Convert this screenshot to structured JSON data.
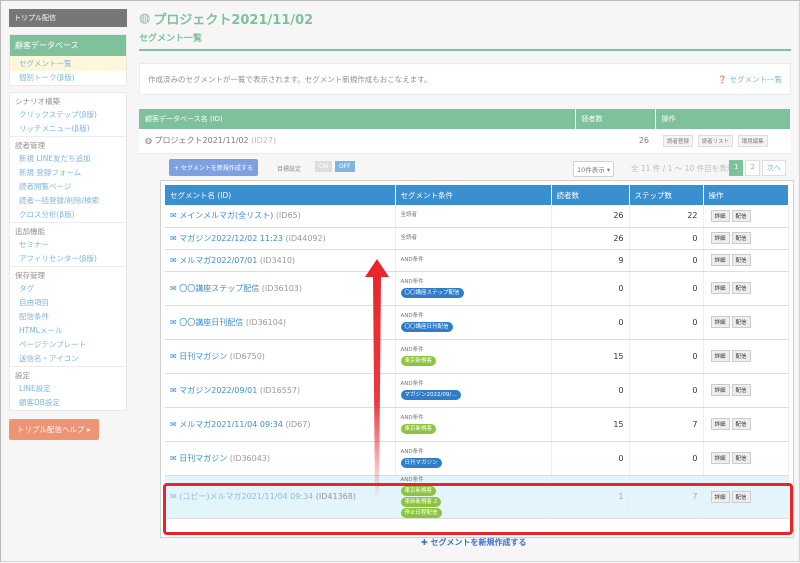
{
  "sidebar": {
    "header": "トリプル配信",
    "active": "顧客データベース",
    "selected": "セグメント一覧",
    "group1_links": [
      "個別トーク(β版)"
    ],
    "categories": [
      {
        "title": "シナリオ構築",
        "links": [
          "クリックステップ(β版)",
          "リッチメニュー(β版)"
        ]
      },
      {
        "title": "読者管理",
        "links": [
          "新規 LINE友だち追加",
          "新規 登録フォーム",
          "読者閲覧ページ",
          "読者一括登録/削除/検索",
          "クロス分析(β版)"
        ]
      },
      {
        "title": "追加機能",
        "links": [
          "セミナー",
          "アフィリセンター(β版)"
        ]
      },
      {
        "title": "保存管理",
        "links": [
          "タグ",
          "自由項目",
          "配信条件",
          "HTMLメール",
          "ページテンプレート",
          "送信名・アイコン"
        ]
      },
      {
        "title": "設定",
        "links": [
          "LINE設定",
          "顧客DB設定"
        ]
      }
    ],
    "help_button": "トリプル配信ヘルプ ▸"
  },
  "header": {
    "title": "プロジェクト2021/11/02",
    "subtitle": "セグメント一覧"
  },
  "description": {
    "text": "作成済みのセグメントが一覧で表示されます。セグメント新規作成もおこなえます。",
    "help_link": "セグメント一覧"
  },
  "db_table": {
    "headers": [
      "顧客データベース名 (ID)",
      "読者数",
      "操作"
    ],
    "row": {
      "name": "プロジェクト2021/11/02",
      "id": "(ID27)",
      "count": "26",
      "buttons": [
        "読者登録",
        "読者リスト",
        "環境編集"
      ]
    }
  },
  "toolbar": {
    "create_button": "+ セグメントを新規作成する",
    "toggle_label": "目標設定",
    "toggle_on": "ON",
    "toggle_off": "OFF",
    "per_page": "10件表示 ▾",
    "page_info": "全 11 件 / 1 〜 10 件目を表示",
    "pages": [
      "1",
      "2",
      "次へ"
    ]
  },
  "seg_table": {
    "headers": [
      "セグメント名 (ID)",
      "セグメント条件",
      "読者数",
      "ステップ数",
      "操作"
    ],
    "buttons": [
      "詳細",
      "配信"
    ],
    "rows": [
      {
        "name": "メインメルマガ(全リスト)",
        "id": "(ID65)",
        "cond": "全読者",
        "tags": [],
        "readers": "26",
        "steps": "22"
      },
      {
        "name": "マガジン2022/12/02 11:23",
        "id": "(ID44092)",
        "cond": "全読者",
        "tags": [],
        "readers": "26",
        "steps": "0"
      },
      {
        "name": "メルマガ2022/07/01",
        "id": "(ID3410)",
        "cond": "AND条件",
        "tags": [],
        "readers": "9",
        "steps": "0"
      },
      {
        "name": "〇〇講座ステップ配信",
        "id": "(ID36103)",
        "cond": "AND条件",
        "tags": [
          {
            "text": "〇〇講座ステップ配信",
            "color": "blue"
          }
        ],
        "readers": "0",
        "steps": "0"
      },
      {
        "name": "〇〇講座日刊配信",
        "id": "(ID36104)",
        "cond": "AND条件",
        "tags": [
          {
            "text": "〇〇講座日刊配信",
            "color": "blue"
          }
        ],
        "readers": "0",
        "steps": "0"
      },
      {
        "name": "日刊マガジン",
        "id": "(ID6750)",
        "cond": "AND条件",
        "tags": [
          {
            "text": "東京新規客",
            "color": "green"
          }
        ],
        "readers": "15",
        "steps": "0"
      },
      {
        "name": "マガジン2022/09/01",
        "id": "(ID16557)",
        "cond": "AND条件",
        "tags": [
          {
            "text": "マガジン2022/09/…",
            "color": "blue"
          }
        ],
        "readers": "0",
        "steps": "0"
      },
      {
        "name": "メルマガ2021/11/04 09:34",
        "id": "(ID67)",
        "cond": "AND条件",
        "tags": [
          {
            "text": "東京新規客",
            "color": "green"
          }
        ],
        "readers": "15",
        "steps": "7"
      },
      {
        "name": "日刊マガジン",
        "id": "(ID36043)",
        "cond": "AND条件",
        "tags": [
          {
            "text": "日刊マガジン",
            "color": "blue"
          }
        ],
        "readers": "0",
        "steps": "0"
      },
      {
        "name": "(コピー)メルマガ2021/11/04 09:34",
        "id": "(ID41368)",
        "cond": "AND条件",
        "tags": [
          {
            "text": "東京新規客",
            "color": "green"
          },
          {
            "text": "東新新規客 2",
            "color": "green"
          },
          {
            "text": "停止日程配信",
            "color": "green"
          }
        ],
        "readers": "1",
        "steps": "7",
        "highlight": true
      }
    ]
  },
  "bottom_add": "✚ セグメントを新規作成する",
  "colors": {
    "green": "#3aa066",
    "blue": "#3a8fd1",
    "highlight_red": "#e8242a",
    "arrow_red": "#e8242a"
  }
}
